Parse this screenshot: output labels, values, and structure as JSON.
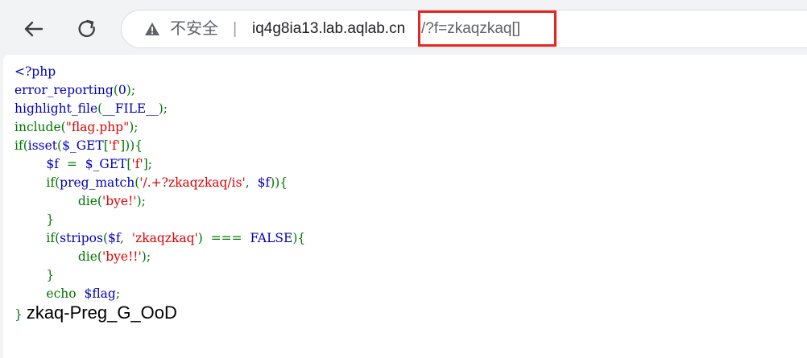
{
  "browser": {
    "insecure_label": "不安全",
    "separator": "|",
    "url_host": "iq4g8ia13.lab.aqlab.cn",
    "url_query": "/?f=zkaqzkaq[]"
  },
  "code": {
    "open_tag": "<?php",
    "l2_func": "error_reporting",
    "l2_open": "(",
    "l2_arg": "0",
    "l2_close": ");",
    "l3_func": "highlight_file",
    "l3_open": "(",
    "l3_arg": "__FILE__",
    "l3_close": ");",
    "l4_kw": "include(",
    "l4_str": "\"flag.php\"",
    "l4_close": ");",
    "l5_if": "if(",
    "l5_isset": "isset",
    "l5_p1": "(",
    "l5_var": "$_GET",
    "l5_p2": "[",
    "l5_str": "'f'",
    "l5_p3": "])){",
    "l6_indent": "        ",
    "l6_var": "$f",
    "l6_eq": "  =  ",
    "l6_get": "$_GET",
    "l6_p1": "[",
    "l6_str": "'f'",
    "l6_p2": "];",
    "l7_indent": "        ",
    "l7_if": "if(",
    "l7_func": "preg_match",
    "l7_p1": "(",
    "l7_str": "'/.+?zkaqzkaq/is'",
    "l7_p2": ",  ",
    "l7_var": "$f",
    "l7_p3": ")){",
    "l8_indent": "                ",
    "l8_die": "die(",
    "l8_str": "'bye!'",
    "l8_p": ");",
    "l9_brace": "        }",
    "l10_indent": "        ",
    "l10_if": "if(",
    "l10_func": "stripos",
    "l10_p1": "(",
    "l10_var": "$f",
    "l10_p2": ",  ",
    "l10_str": "'zkaqzkaq'",
    "l10_p3": ")  ===  ",
    "l10_false": "FALSE",
    "l10_p4": "){",
    "l11_indent": "                ",
    "l11_die": "die(",
    "l11_str": "'bye!!'",
    "l11_p": ");",
    "l12_brace": "        }",
    "l13_indent": "        ",
    "l13_echo": "echo  ",
    "l13_var": "$flag",
    "l13_semi": ";",
    "l14_brace": "}"
  },
  "output": {
    "flag_text": "zkaq-Preg_G_OoD"
  },
  "colors": {
    "default": "#0000bb",
    "keyword": "#007700",
    "string": "#dd0000",
    "highlight_box": "#e8261f"
  }
}
